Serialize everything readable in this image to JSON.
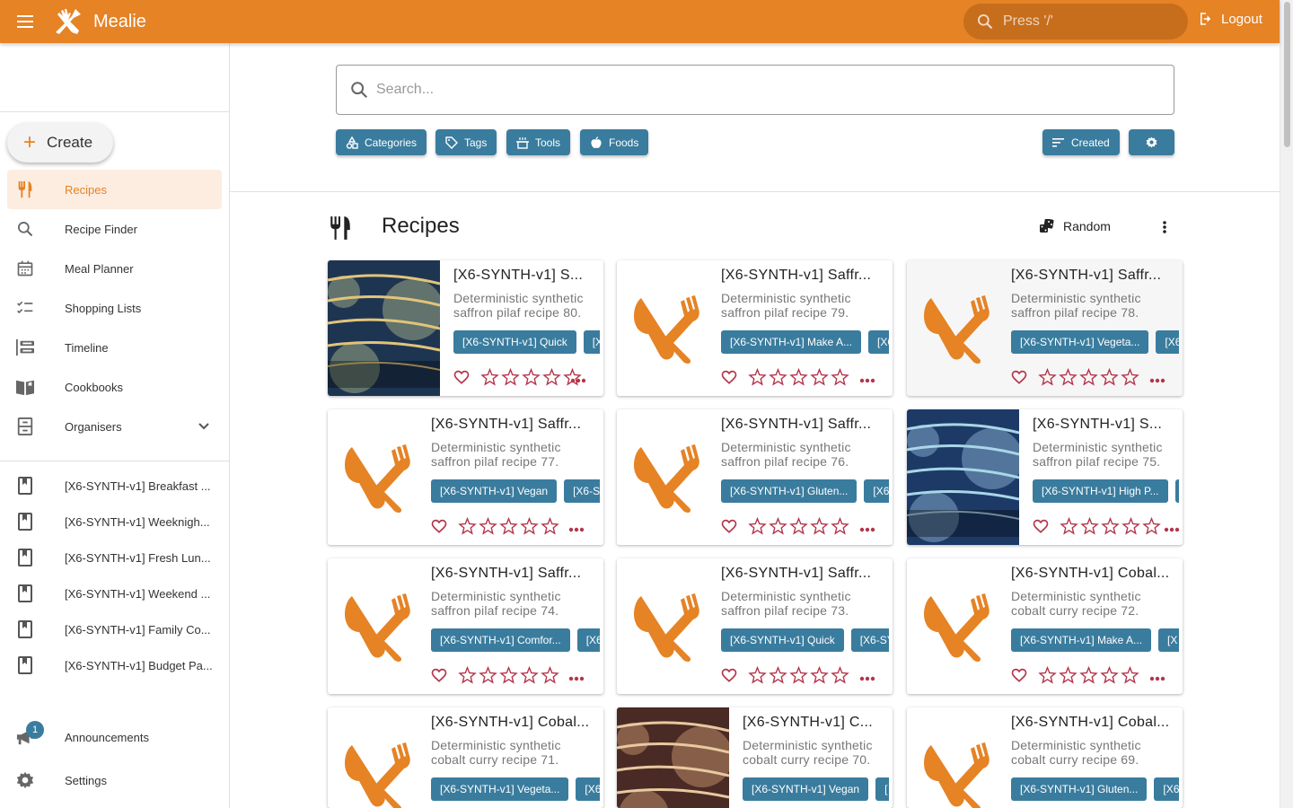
{
  "app": {
    "title": "Mealie"
  },
  "topbar": {
    "search_placeholder": "Press '/'",
    "logout_label": "Logout"
  },
  "sidebar": {
    "create_label": "Create",
    "nav": [
      {
        "label": "Recipes",
        "icon": "fork-knife-icon"
      },
      {
        "label": "Recipe Finder",
        "icon": "search-icon"
      },
      {
        "label": "Meal Planner",
        "icon": "calendar-icon"
      },
      {
        "label": "Shopping Lists",
        "icon": "checklist-icon"
      },
      {
        "label": "Timeline",
        "icon": "timeline-icon"
      },
      {
        "label": "Cookbooks",
        "icon": "book-open-icon"
      },
      {
        "label": "Organisers",
        "icon": "file-cabinet-icon"
      }
    ],
    "cookbooks": [
      "[X6-SYNTH-v1] Breakfast ...",
      "[X6-SYNTH-v1] Weeknigh...",
      "[X6-SYNTH-v1] Fresh Lun...",
      "[X6-SYNTH-v1] Weekend ...",
      "[X6-SYNTH-v1] Family Co...",
      "[X6-SYNTH-v1] Budget Pa..."
    ],
    "announcements_label": "Announcements",
    "announcements_badge": "1",
    "settings_label": "Settings"
  },
  "main": {
    "search_placeholder": "Search...",
    "filters": [
      "Categories",
      "Tags",
      "Tools",
      "Foods"
    ],
    "sort_label": "Created",
    "section_title": "Recipes",
    "random_label": "Random"
  },
  "recipes": [
    {
      "title": "[X6-SYNTH-v1] S...",
      "desc1": "Deterministic synthetic",
      "desc2": "saffron pilaf recipe 80.",
      "tags": [
        "[X6-SYNTH-v1] Quick",
        "[X"
      ],
      "image": "navy"
    },
    {
      "title": "[X6-SYNTH-v1] Saffr...",
      "desc1": "Deterministic synthetic",
      "desc2": "saffron pilaf recipe 79.",
      "tags": [
        "[X6-SYNTH-v1] Make A...",
        "[X6"
      ],
      "image": "none"
    },
    {
      "title": "[X6-SYNTH-v1] Saffr...",
      "desc1": "Deterministic synthetic",
      "desc2": "saffron pilaf recipe 78.",
      "tags": [
        "[X6-SYNTH-v1] Vegeta...",
        "[X6"
      ],
      "image": "none"
    },
    {
      "title": "[X6-SYNTH-v1] Saffr...",
      "desc1": "Deterministic synthetic",
      "desc2": "saffron pilaf recipe 77.",
      "tags": [
        "[X6-SYNTH-v1] Vegan",
        "[X6-S"
      ],
      "image": "none"
    },
    {
      "title": "[X6-SYNTH-v1] Saffr...",
      "desc1": "Deterministic synthetic",
      "desc2": "saffron pilaf recipe 76.",
      "tags": [
        "[X6-SYNTH-v1] Gluten...",
        "[X6"
      ],
      "image": "none"
    },
    {
      "title": "[X6-SYNTH-v1] S...",
      "desc1": "Deterministic synthetic",
      "desc2": "saffron pilaf recipe 75.",
      "tags": [
        "[X6-SYNTH-v1] High P...",
        "["
      ],
      "image": "blue"
    },
    {
      "title": "[X6-SYNTH-v1] Saffr...",
      "desc1": "Deterministic synthetic",
      "desc2": "saffron pilaf recipe 74.",
      "tags": [
        "[X6-SYNTH-v1] Comfor...",
        "[X6"
      ],
      "image": "none"
    },
    {
      "title": "[X6-SYNTH-v1] Saffr...",
      "desc1": "Deterministic synthetic",
      "desc2": "saffron pilaf recipe 73.",
      "tags": [
        "[X6-SYNTH-v1] Quick",
        "[X6-SY"
      ],
      "image": "none"
    },
    {
      "title": "[X6-SYNTH-v1] Cobal...",
      "desc1": "Deterministic synthetic",
      "desc2": "cobalt curry recipe 72.",
      "tags": [
        "[X6-SYNTH-v1] Make A...",
        "[X"
      ],
      "image": "none"
    },
    {
      "title": "[X6-SYNTH-v1] Cobal...",
      "desc1": "Deterministic synthetic",
      "desc2": "cobalt curry recipe 71.",
      "tags": [
        "[X6-SYNTH-v1] Vegeta...",
        "[X6"
      ],
      "image": "none"
    },
    {
      "title": "[X6-SYNTH-v1] C...",
      "desc1": "Deterministic synthetic",
      "desc2": "cobalt curry recipe 70.",
      "tags": [
        "[X6-SYNTH-v1] Vegan",
        "["
      ],
      "image": "brown"
    },
    {
      "title": "[X6-SYNTH-v1] Cobal...",
      "desc1": "Deterministic synthetic",
      "desc2": "cobalt curry recipe 69.",
      "tags": [
        "[X6-SYNTH-v1] Gluten...",
        "[X6"
      ],
      "image": "none"
    }
  ],
  "colors": {
    "primary": "#E58325",
    "secondary": "#3A7C9E",
    "heart": "#B4354A"
  }
}
